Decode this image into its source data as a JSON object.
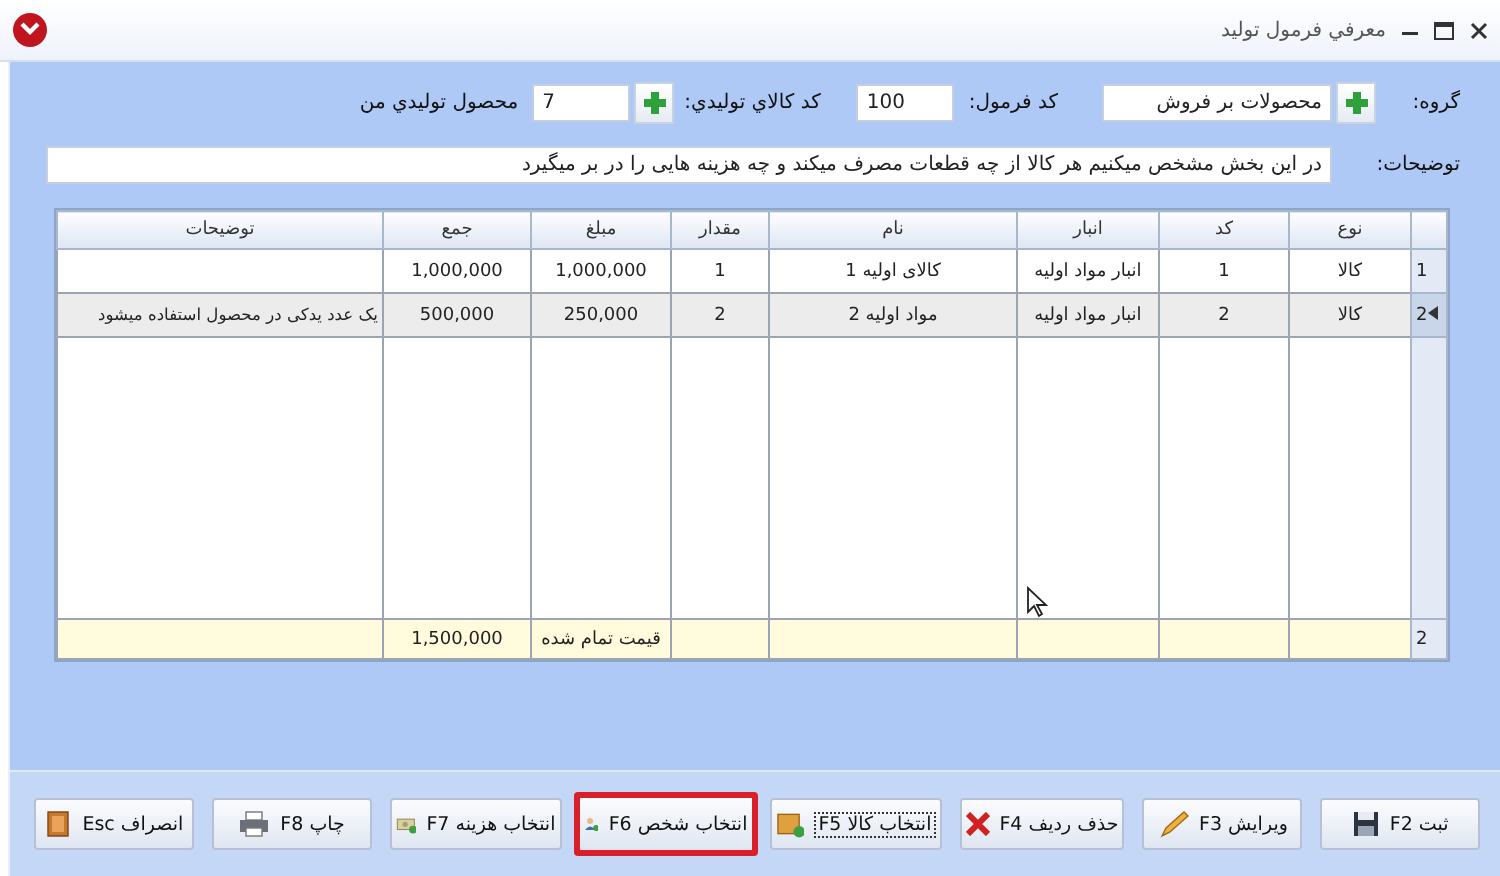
{
  "window": {
    "title": "معرفي فرمول توليد"
  },
  "form": {
    "group": {
      "label": "گروه:",
      "value": "محصولات بر فروش"
    },
    "formula_code": {
      "label": "کد فرمول:",
      "value": "100"
    },
    "product_code": {
      "label": "کد کالاي توليدي:",
      "value": "7"
    },
    "product_name": "محصول توليدي من",
    "description": {
      "label": "توضیحات:",
      "value": "در این بخش مشخص میکنیم هر کالا از چه قطعات مصرف میکند و چه هزینه هایی را در بر میگیرد"
    }
  },
  "table": {
    "columns": [
      "نوع",
      "کد",
      "انبار",
      "نام",
      "مقدار",
      "مبلغ",
      "جمع",
      "توضیحات"
    ],
    "rows": [
      {
        "number": "1",
        "selected": false,
        "cells": [
          "کالا",
          "1",
          "انبار مواد اولیه",
          "کالای اولیه 1",
          "1",
          "1,000,000",
          "1,000,000",
          ""
        ]
      },
      {
        "number": "2",
        "selected": true,
        "cells": [
          "کالا",
          "2",
          "انبار مواد اولیه",
          "مواد اولیه 2",
          "2",
          "250,000",
          "500,000",
          "یک عدد یدکی در محصول استفاده میشود"
        ]
      }
    ],
    "footer": {
      "number": "2",
      "cells": [
        "",
        "",
        "",
        "",
        "",
        "قیمت تمام شده",
        "1,500,000",
        ""
      ]
    }
  },
  "buttons": [
    {
      "label": "ثبت F2",
      "kind": "save",
      "highlighted": false,
      "focused": false
    },
    {
      "label": "ویرایش F3",
      "kind": "edit",
      "highlighted": false,
      "focused": false
    },
    {
      "label": "حذف ردیف F4",
      "kind": "delete",
      "highlighted": false,
      "focused": false
    },
    {
      "label": "انتخاب کالا F5",
      "kind": "goods",
      "highlighted": false,
      "focused": true
    },
    {
      "label": "انتخاب شخص F6",
      "kind": "person",
      "highlighted": true,
      "focused": false
    },
    {
      "label": "انتخاب هزینه F7",
      "kind": "money",
      "highlighted": false,
      "focused": false
    },
    {
      "label": "چاپ F8",
      "kind": "print",
      "highlighted": false,
      "focused": false
    },
    {
      "label": "انصراف Esc",
      "kind": "exit",
      "highlighted": false,
      "focused": false
    }
  ]
}
